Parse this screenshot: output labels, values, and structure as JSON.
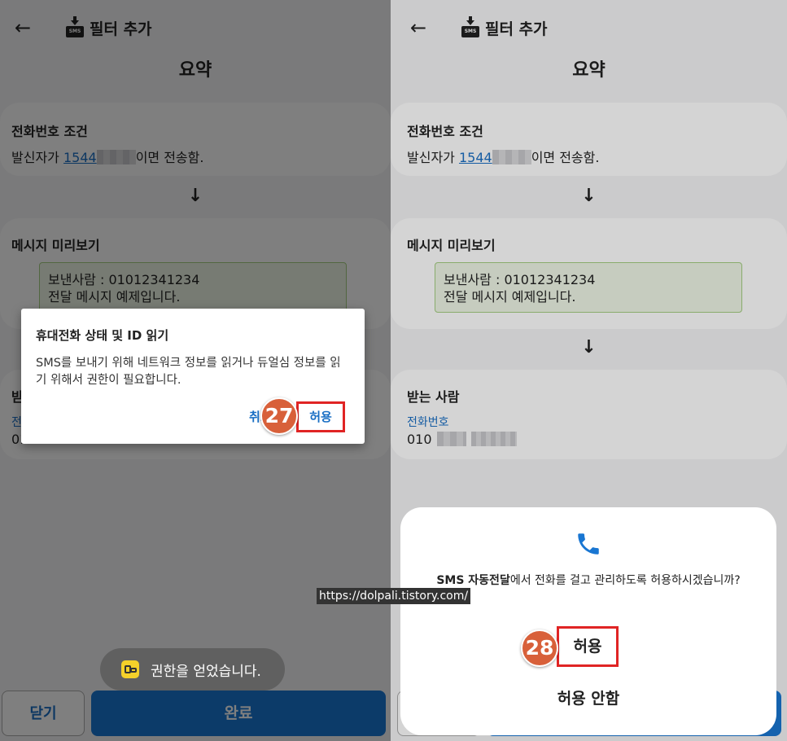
{
  "header": {
    "title": "필터 추가",
    "sms_badge": "SMS"
  },
  "page_title": "요약",
  "phone_condition": {
    "title": "전화번호 조건",
    "prefix": "발신자가 ",
    "number": "1544",
    "suffix": "이면 전송함."
  },
  "message_preview": {
    "title": "메시지 미리보기",
    "line1": "보낸사람 : 01012341234",
    "line2": "전달 메시지 예제입니다."
  },
  "recipient": {
    "title": "받는 사람",
    "label": "전화번호",
    "number_prefix": "010"
  },
  "buttons": {
    "close": "닫기",
    "done": "완료"
  },
  "permission_dialog": {
    "title": "휴대전화 상태 및 ID 읽기",
    "body": "SMS를 보내기 위해 네트워크 정보를 읽거나 듀얼심 정보를 읽기 위해서 권한이 필요합니다.",
    "deny": "취소",
    "allow": "허용"
  },
  "toast": {
    "text": "권한을 얻었습니다."
  },
  "call_sheet": {
    "app_name": "SMS 자동전달",
    "message_rest": "에서 전화를 걸고 관리하도록 허용하시겠습니까?",
    "allow": "허용",
    "deny": "허용 안함"
  },
  "steps": {
    "left": "27",
    "right": "28"
  },
  "watermark": "https://dolpali.tistory.com/",
  "colors": {
    "accent": "#1976d2",
    "link": "#1a6fc4",
    "highlight": "#e02424",
    "step_badge": "#d8603a"
  }
}
